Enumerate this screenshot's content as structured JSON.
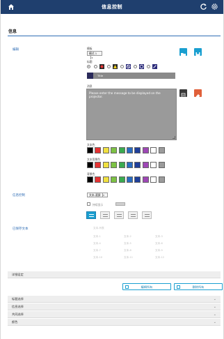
{
  "header": {
    "title": "信息控制",
    "home_icon": "home-icon",
    "refresh_icon": "refresh-icon",
    "settings_icon": "gear-icon"
  },
  "section": {
    "title": "信息"
  },
  "edit": {
    "label": "编辑",
    "mode_label": "模板",
    "mode_value": "模式 1",
    "icon_label": "标题",
    "title_value": "Title",
    "message_label": "消息",
    "message_placeholder": "Please enter the message to be displayed on the projector.",
    "text_color_label": "文本色",
    "text_bg_label": "文本背景色",
    "bg_color_label": "背景色"
  },
  "colors": {
    "accent": "#1a9fd0",
    "header": "#1f3f6e",
    "palette": [
      "#000000",
      "#e53333",
      "#f0e040",
      "#7dc244",
      "#3aaa50",
      "#2a6cc0",
      "#1f3f9a",
      "#9e47b5",
      "#ffffff",
      "#9b9b9b"
    ]
  },
  "display": {
    "label": "信息控制",
    "mode_value": "文本-滚屏",
    "blink_label": "持续显示"
  },
  "saved": {
    "label": "已保存文本",
    "items": [
      "文本-列表",
      "文本-1",
      "文本-2",
      "文本-3",
      "文本-4",
      "文本-5",
      "文本-6",
      "文本-7",
      "文本-8",
      "文本-9",
      "文本-10",
      "文本-11",
      "文本-12"
    ]
  },
  "detail": {
    "label": "详细设定",
    "apply_label": "编辑所有",
    "delete_label": "删除所有"
  },
  "groups": [
    {
      "label": "标题选择"
    },
    {
      "label": "信息选择"
    },
    {
      "label": "共同选择"
    },
    {
      "label": "颜色"
    }
  ]
}
